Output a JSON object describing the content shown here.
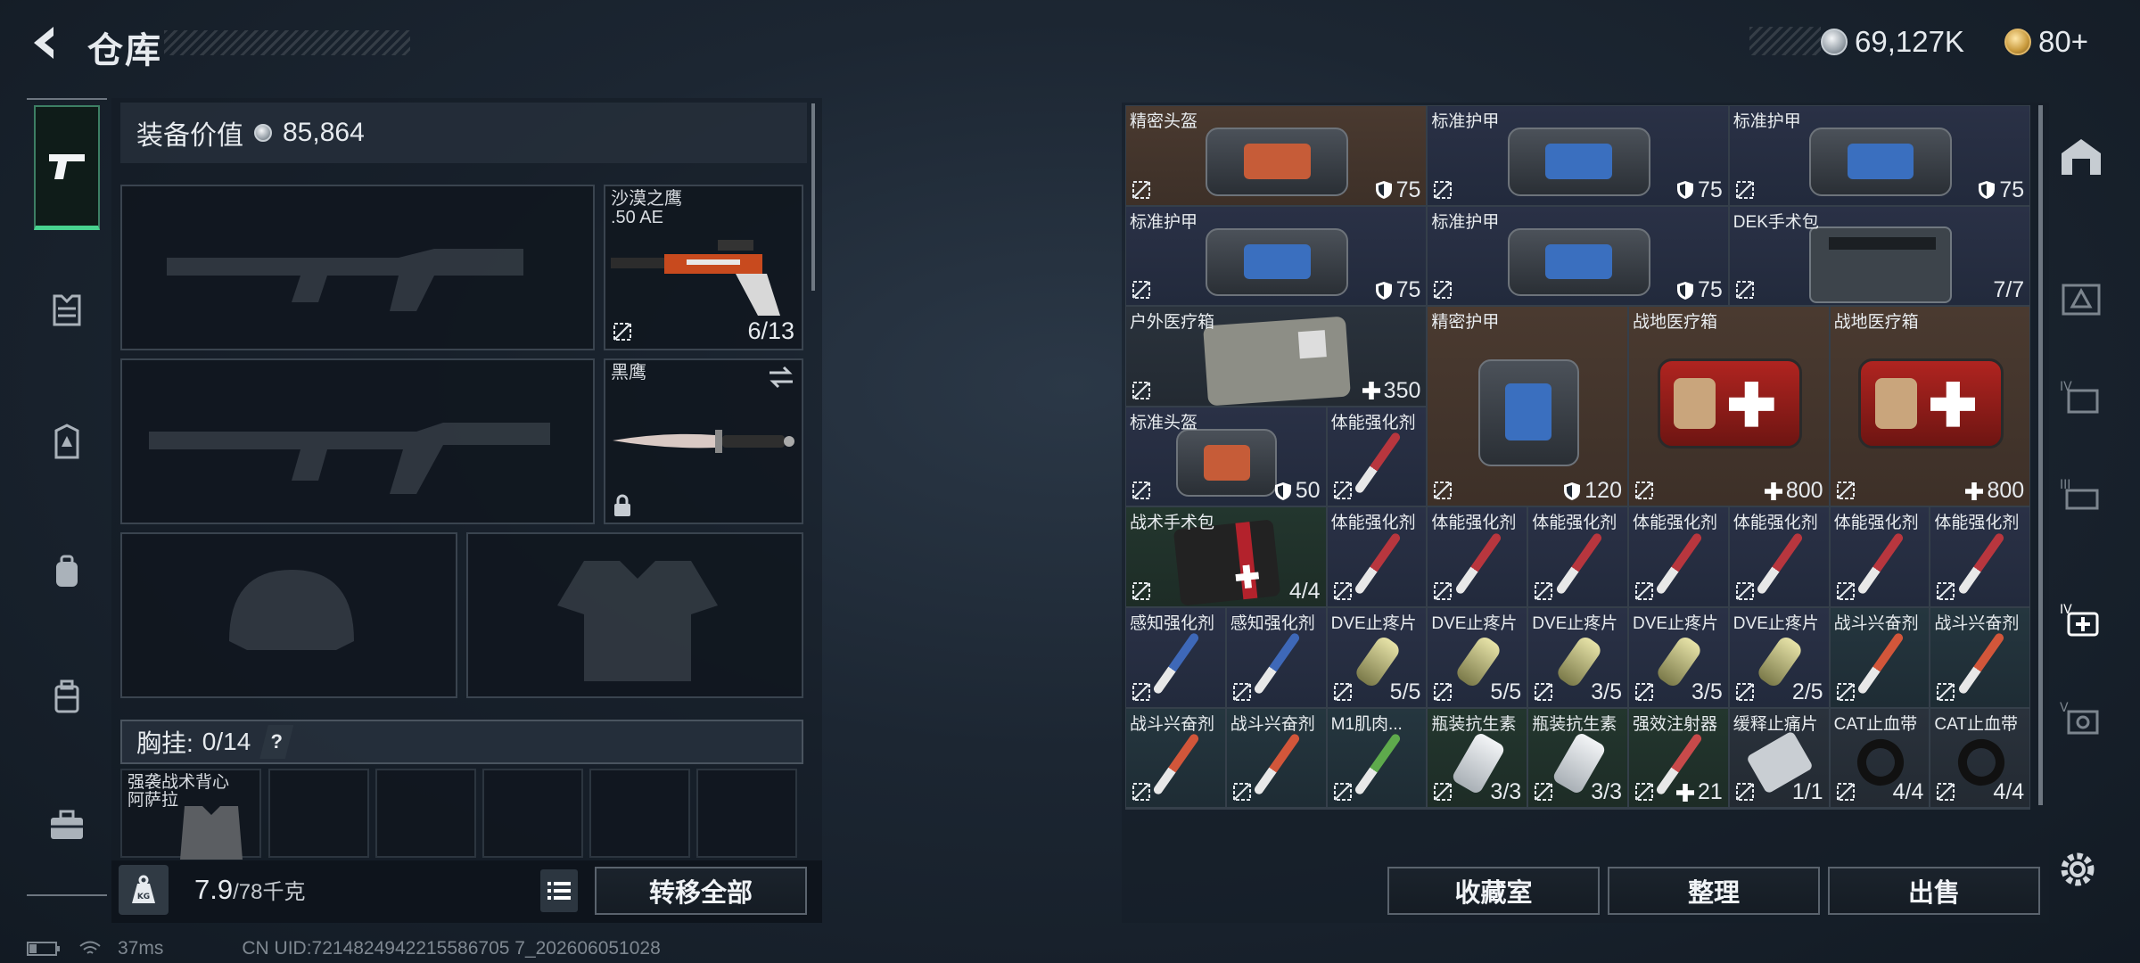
{
  "header": {
    "title": "仓库",
    "currency_silver": "69,127K",
    "currency_gold": "80+"
  },
  "loadout": {
    "value_label": "装备价值",
    "value": "85,864",
    "slots": {
      "primary_1": {
        "name": ""
      },
      "primary_2": {
        "name": ""
      },
      "sidearm": {
        "name": "沙漠之鹰",
        "caliber": ".50 AE",
        "ammo": "6/13"
      },
      "melee": {
        "name": "黑鹰"
      },
      "helmet": {
        "name": ""
      },
      "armor": {
        "name": ""
      }
    },
    "chest_rig": {
      "label": "胸挂:",
      "count": "0/14",
      "help": "?"
    },
    "backpack_item": {
      "name": "强袭战术背心\n阿萨拉"
    },
    "weight": {
      "value": "7.9",
      "limit": "/78千克"
    },
    "transfer_all_label": "转移全部"
  },
  "stash": {
    "items": [
      {
        "name": "精密头盔",
        "value": "75",
        "icon": "shield-icon"
      },
      {
        "name": "标准护甲",
        "value": "75",
        "icon": "shield-icon"
      },
      {
        "name": "标准护甲",
        "value": "75",
        "icon": "shield-icon"
      },
      {
        "name": "标准护甲",
        "value": "75",
        "icon": "shield-icon"
      },
      {
        "name": "标准护甲",
        "value": "75",
        "icon": "shield-icon"
      },
      {
        "name": "DEK手术包",
        "value": "7/7",
        "icon": ""
      },
      {
        "name": "户外医疗箱",
        "value": "350",
        "icon": "plus-icon"
      },
      {
        "name": "精密护甲",
        "value": "120",
        "icon": "shield-icon"
      },
      {
        "name": "战地医疗箱",
        "value": "800",
        "icon": "plus-icon"
      },
      {
        "name": "战地医疗箱",
        "value": "800",
        "icon": "plus-icon"
      },
      {
        "name": "标准头盔",
        "value": "50",
        "icon": "shield-icon"
      },
      {
        "name": "体能强化剂",
        "value": "",
        "icon": ""
      },
      {
        "name": "战术手术包",
        "value": "4/4",
        "icon": ""
      },
      {
        "name": "体能强化剂",
        "value": "",
        "icon": ""
      },
      {
        "name": "体能强化剂",
        "value": "",
        "icon": ""
      },
      {
        "name": "体能强化剂",
        "value": "",
        "icon": ""
      },
      {
        "name": "体能强化剂",
        "value": "",
        "icon": ""
      },
      {
        "name": "体能强化剂",
        "value": "",
        "icon": ""
      },
      {
        "name": "体能强化剂",
        "value": "",
        "icon": ""
      },
      {
        "name": "体能强化剂",
        "value": "",
        "icon": ""
      },
      {
        "name": "感知强化剂",
        "value": "",
        "icon": ""
      },
      {
        "name": "感知强化剂",
        "value": "",
        "icon": ""
      },
      {
        "name": "DVE止疼片",
        "value": "5/5",
        "icon": ""
      },
      {
        "name": "DVE止疼片",
        "value": "5/5",
        "icon": ""
      },
      {
        "name": "DVE止疼片",
        "value": "3/5",
        "icon": ""
      },
      {
        "name": "DVE止疼片",
        "value": "3/5",
        "icon": ""
      },
      {
        "name": "DVE止疼片",
        "value": "2/5",
        "icon": ""
      },
      {
        "name": "战斗兴奋剂",
        "value": "",
        "icon": ""
      },
      {
        "name": "战斗兴奋剂",
        "value": "",
        "icon": ""
      },
      {
        "name": "战斗兴奋剂",
        "value": "",
        "icon": ""
      },
      {
        "name": "战斗兴奋剂",
        "value": "",
        "icon": ""
      },
      {
        "name": "M1肌肉...",
        "value": "",
        "icon": ""
      },
      {
        "name": "瓶装抗生素",
        "value": "3/3",
        "icon": ""
      },
      {
        "name": "瓶装抗生素",
        "value": "3/3",
        "icon": ""
      },
      {
        "name": "强效注射器",
        "value": "21",
        "icon": "plus-icon"
      },
      {
        "name": "缓释止痛片",
        "value": "1/1",
        "icon": ""
      },
      {
        "name": "CAT止血带",
        "value": "4/4",
        "icon": ""
      },
      {
        "name": "CAT止血带",
        "value": "4/4",
        "icon": ""
      }
    ],
    "buttons": {
      "collection": "收藏室",
      "sort": "整理",
      "sell": "出售"
    }
  },
  "status_bar": {
    "ping": "37ms",
    "uid": "CN UID:7214824942215586705 7_202606051028"
  },
  "colors": {
    "accent_green": "#48d38f",
    "rarity_orange": "#4a3a30",
    "rarity_blue": "#2a3146",
    "rarity_green": "#23362e"
  }
}
